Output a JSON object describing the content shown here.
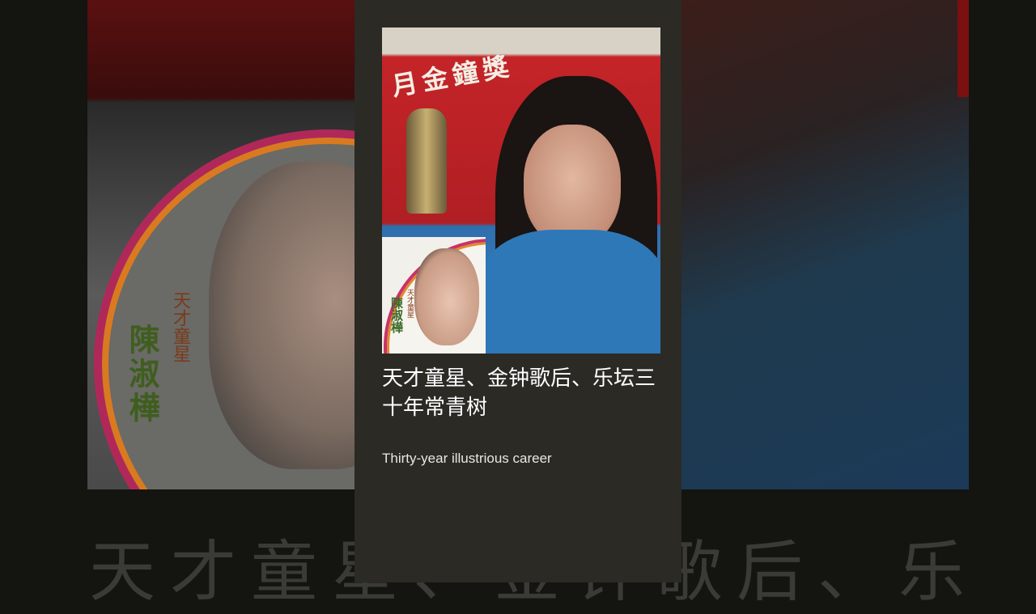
{
  "background": {
    "left_vertical_name": "陳淑樺",
    "left_vertical_tag": "天才童星",
    "bottom_echo_text": "天才童星、金钟歌后、乐"
  },
  "card": {
    "photo": {
      "banner_text": "月金鐘獎",
      "inset_name": "陳淑樺",
      "inset_tag": "天才童星"
    },
    "title": "天才童星、金钟歌后、乐坛三十年常青树",
    "subtitle": "Thirty-year illustrious career"
  },
  "colors": {
    "card_bg": "#2b2a25",
    "page_bg": "#141410",
    "title_text": "#ffffff"
  }
}
